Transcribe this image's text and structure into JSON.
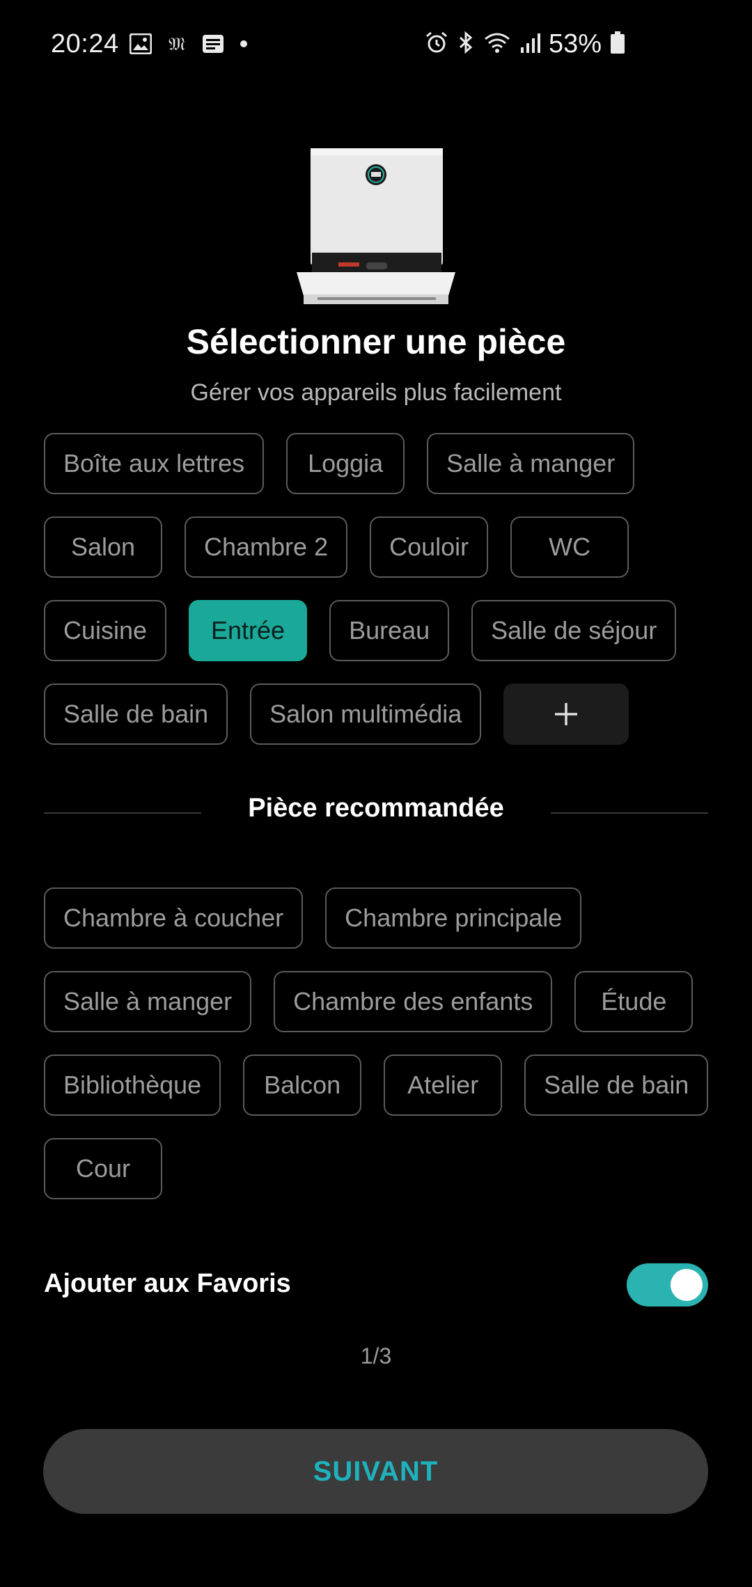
{
  "status_bar": {
    "time": "20:24",
    "battery_percent": "53%",
    "left_icons": [
      "gallery-icon",
      "le-monde-icon",
      "news-icon",
      "dot-icon"
    ],
    "right_icons": [
      "alarm-icon",
      "bluetooth-icon",
      "wifi-icon",
      "signal-icon",
      "battery-icon"
    ]
  },
  "header": {
    "title": "Sélectionner une pièce",
    "subtitle": "Gérer vos appareils plus facilement"
  },
  "rooms": [
    {
      "label": "Boîte aux lettres",
      "selected": false
    },
    {
      "label": "Loggia",
      "selected": false
    },
    {
      "label": "Salle à manger",
      "selected": false
    },
    {
      "label": "Salon",
      "selected": false
    },
    {
      "label": "Chambre 2",
      "selected": false
    },
    {
      "label": "Couloir",
      "selected": false
    },
    {
      "label": "WC",
      "selected": false
    },
    {
      "label": "Cuisine",
      "selected": false
    },
    {
      "label": "Entrée",
      "selected": true
    },
    {
      "label": "Bureau",
      "selected": false
    },
    {
      "label": "Salle de séjour",
      "selected": false
    },
    {
      "label": "Salle de bain",
      "selected": false
    },
    {
      "label": "Salon multimédia",
      "selected": false
    }
  ],
  "recommended": {
    "heading": "Pièce recommandée",
    "rooms": [
      {
        "label": "Chambre à coucher"
      },
      {
        "label": "Chambre principale"
      },
      {
        "label": "Salle à manger"
      },
      {
        "label": "Chambre des enfants"
      },
      {
        "label": "Étude"
      },
      {
        "label": "Bibliothèque"
      },
      {
        "label": "Balcon"
      },
      {
        "label": "Atelier"
      },
      {
        "label": "Salle de bain"
      },
      {
        "label": "Cour"
      }
    ]
  },
  "favorites": {
    "label": "Ajouter aux Favoris",
    "enabled": true
  },
  "pager": "1/3",
  "next_button": "SUIVANT",
  "colors": {
    "selected_chip": "#1aa998",
    "toggle_on": "#2ab3b1",
    "button_text": "#1fb2bd"
  }
}
